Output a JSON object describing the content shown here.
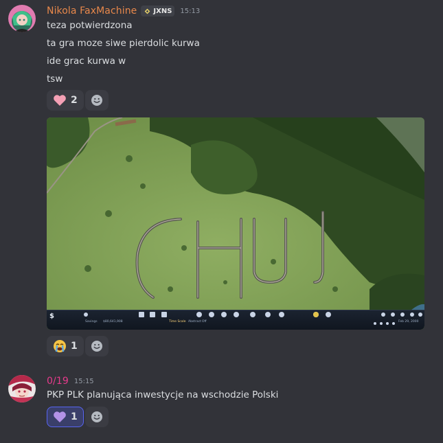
{
  "messages": [
    {
      "username": "Nikola FaxMachine",
      "username_color": "#e8884b",
      "tag": "JXNS",
      "time": "15:13",
      "lines": [
        "teza potwierdzona",
        "ta gra moze siwe pierdolic kurwa",
        "ide grac kurwa w",
        "tsw"
      ],
      "reactions": [
        {
          "emoji": "pink-heart",
          "count": "2"
        }
      ]
    },
    {
      "attachment": {
        "type": "game-screenshot",
        "hud": {
          "money_symbol": "$",
          "savings_label": "Savings",
          "savings_value": "$80,641,908",
          "speed_label": "Time Scale",
          "mode_label": "Abstract",
          "mode_value": "Off",
          "date": "Feb 29, 2000"
        }
      },
      "reactions": [
        {
          "emoji": "loudly-crying-face",
          "count": "1"
        }
      ]
    },
    {
      "username": "0/19",
      "username_color": "#e73b8c",
      "time": "15:15",
      "lines": [
        "PKP PLK planująca inwestycje na wschodzie Polski"
      ],
      "reactions": [
        {
          "emoji": "purple-heart",
          "count": "1",
          "active": true
        }
      ]
    }
  ],
  "colors": {
    "background": "#323339",
    "text": "#dbdee1",
    "muted": "#949ba4",
    "reaction_bg": "#3b3c43",
    "reaction_active_border": "#5865f2"
  }
}
